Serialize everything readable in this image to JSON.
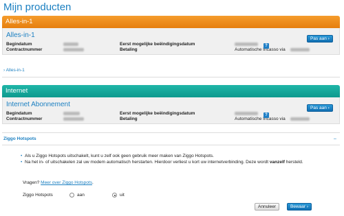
{
  "page": {
    "title": "Mijn producten"
  },
  "product1": {
    "section_title": "Alles-in-1",
    "panel_title": "Alles-in-1",
    "begindatum_label": "Begindatum",
    "contractnummer_label": "Contractnummer",
    "einddatum_label": "Eerst mogelijke beëindigingsdatum",
    "betaling_label": "Betaling",
    "betaling_value": "Automatische Incasso via",
    "button_label": "Pas aan",
    "breadcrumb": "› Alles-in-1"
  },
  "product2": {
    "section_title": "Internet",
    "panel_title": "Internet Abonnement",
    "begindatum_label": "Begindatum",
    "contractnummer_label": "Contractnummer",
    "einddatum_label": "Eerst mogelijke beëindigingsdatum",
    "betaling_label": "Betaling",
    "betaling_value": "Automatische Incasso via",
    "button_label": "Pas aan"
  },
  "hotspots": {
    "title": "Ziggo Hotspots",
    "collapse_glyph": "–",
    "bullet1": "Als u Ziggo Hotspots uitschakelt, kunt u zelf ook geen gebruik meer maken van Ziggo Hotspots.",
    "bullet2_a": "Na het in- of uitschakelen zal uw modem automatisch herstarten. Hierdoor verliest u kort uw internetverbinding. Deze wordt",
    "bullet2_b_bold": "vanzelf",
    "bullet2_c": "hersteld.",
    "vragen_label": "Vragen?",
    "vragen_link": "Meer over Ziggo Hotspots",
    "vragen_suffix": ".",
    "field_label": "Ziggo Hotspots",
    "option_on": "aan",
    "option_off": "uit",
    "selected": "uit",
    "cancel_label": "Annuleer",
    "save_label": "Bewaar"
  },
  "icons": {
    "help": "?",
    "arrow": "›"
  },
  "colors": {
    "accent_blue": "#1a7fc1",
    "orange": "#f08c1c",
    "teal": "#15a99c"
  }
}
